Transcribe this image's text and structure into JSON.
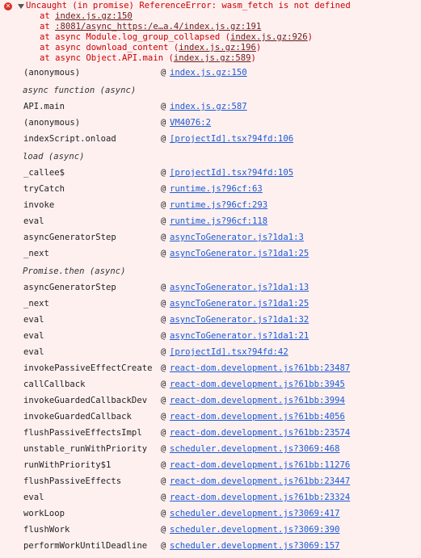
{
  "error": {
    "message": "Uncaught (in promise) ReferenceError: wasm_fetch is not defined",
    "stack": [
      {
        "prefix": "at ",
        "link": "index.js.gz:150",
        "suffix": ""
      },
      {
        "prefix": "at ",
        "link": ":8081/async_https:/e…a.4/index.js.gz:191",
        "suffix": ""
      },
      {
        "prefix": "at async Module.log_group_collapsed (",
        "link": "index.js.gz:926",
        "suffix": ")"
      },
      {
        "prefix": "at async download_content (",
        "link": "index.js.gz:196",
        "suffix": ")"
      },
      {
        "prefix": "at async Object.API.main (",
        "link": "index.js.gz:589",
        "suffix": ")"
      }
    ]
  },
  "at_symbol": "@",
  "frames": [
    {
      "type": "frame",
      "fn": "(anonymous)",
      "loc": "index.js.gz:150"
    },
    {
      "type": "async",
      "label": "async function (async)"
    },
    {
      "type": "frame",
      "fn": "API.main",
      "loc": "index.js.gz:587"
    },
    {
      "type": "frame",
      "fn": "(anonymous)",
      "loc": "VM4076:2"
    },
    {
      "type": "frame",
      "fn": "indexScript.onload",
      "loc": "[projectId].tsx?94fd:106"
    },
    {
      "type": "async",
      "label": "load (async)"
    },
    {
      "type": "frame",
      "fn": "_callee$",
      "loc": "[projectId].tsx?94fd:105"
    },
    {
      "type": "frame",
      "fn": "tryCatch",
      "loc": "runtime.js?96cf:63"
    },
    {
      "type": "frame",
      "fn": "invoke",
      "loc": "runtime.js?96cf:293"
    },
    {
      "type": "frame",
      "fn": "eval",
      "loc": "runtime.js?96cf:118"
    },
    {
      "type": "frame",
      "fn": "asyncGeneratorStep",
      "loc": "asyncToGenerator.js?1da1:3"
    },
    {
      "type": "frame",
      "fn": "_next",
      "loc": "asyncToGenerator.js?1da1:25"
    },
    {
      "type": "async",
      "label": "Promise.then (async)"
    },
    {
      "type": "frame",
      "fn": "asyncGeneratorStep",
      "loc": "asyncToGenerator.js?1da1:13"
    },
    {
      "type": "frame",
      "fn": "_next",
      "loc": "asyncToGenerator.js?1da1:25"
    },
    {
      "type": "frame",
      "fn": "eval",
      "loc": "asyncToGenerator.js?1da1:32"
    },
    {
      "type": "frame",
      "fn": "eval",
      "loc": "asyncToGenerator.js?1da1:21"
    },
    {
      "type": "frame",
      "fn": "eval",
      "loc": "[projectId].tsx?94fd:42"
    },
    {
      "type": "frame",
      "fn": "invokePassiveEffectCreate",
      "loc": "react-dom.development.js?61bb:23487"
    },
    {
      "type": "frame",
      "fn": "callCallback",
      "loc": "react-dom.development.js?61bb:3945"
    },
    {
      "type": "frame",
      "fn": "invokeGuardedCallbackDev",
      "loc": "react-dom.development.js?61bb:3994"
    },
    {
      "type": "frame",
      "fn": "invokeGuardedCallback",
      "loc": "react-dom.development.js?61bb:4056"
    },
    {
      "type": "frame",
      "fn": "flushPassiveEffectsImpl",
      "loc": "react-dom.development.js?61bb:23574"
    },
    {
      "type": "frame",
      "fn": "unstable_runWithPriority",
      "loc": "scheduler.development.js?3069:468"
    },
    {
      "type": "frame",
      "fn": "runWithPriority$1",
      "loc": "react-dom.development.js?61bb:11276"
    },
    {
      "type": "frame",
      "fn": "flushPassiveEffects",
      "loc": "react-dom.development.js?61bb:23447"
    },
    {
      "type": "frame",
      "fn": "eval",
      "loc": "react-dom.development.js?61bb:23324"
    },
    {
      "type": "frame",
      "fn": "workLoop",
      "loc": "scheduler.development.js?3069:417"
    },
    {
      "type": "frame",
      "fn": "flushWork",
      "loc": "scheduler.development.js?3069:390"
    },
    {
      "type": "frame",
      "fn": "performWorkUntilDeadline",
      "loc": "scheduler.development.js?3069:157"
    }
  ]
}
